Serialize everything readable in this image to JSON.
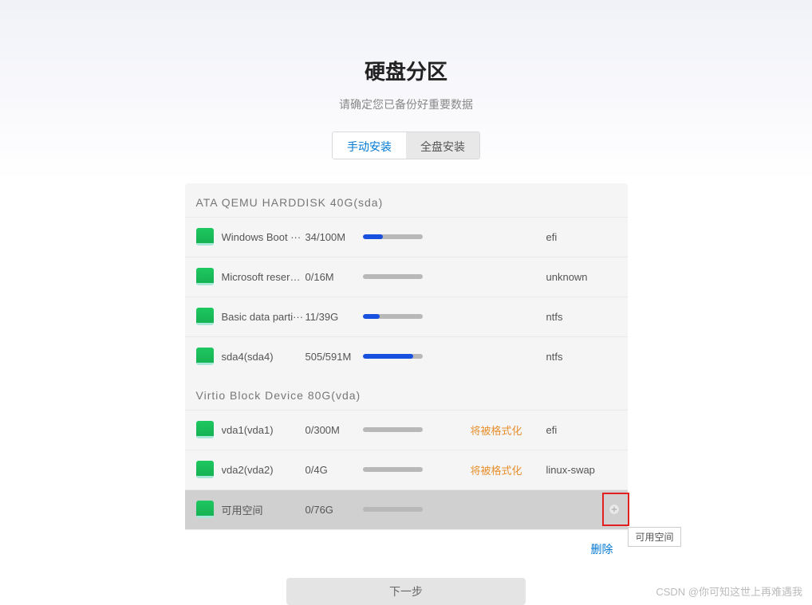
{
  "header": {
    "title": "硬盘分区",
    "subtitle": "请确定您已备份好重要数据"
  },
  "tabs": {
    "manual": "手动安装",
    "full": "全盘安装"
  },
  "disks": [
    {
      "label": "ATA  QEMU  HARDDISK  40G(sda)",
      "partitions": [
        {
          "name": "Windows Boot ···",
          "size": "34/100M",
          "progress": 34,
          "status": "",
          "fs": "efi"
        },
        {
          "name": "Microsoft reserv···",
          "size": "0/16M",
          "progress": 0,
          "status": "",
          "fs": "unknown"
        },
        {
          "name": "Basic  data  parti···",
          "size": "11/39G",
          "progress": 28,
          "status": "",
          "fs": "ntfs"
        },
        {
          "name": "sda4(sda4)",
          "size": "505/591M",
          "progress": 85,
          "status": "",
          "fs": "ntfs"
        }
      ]
    },
    {
      "label": "Virtio  Block  Device  80G(vda)",
      "partitions": [
        {
          "name": "vda1(vda1)",
          "size": "0/300M",
          "progress": 0,
          "status": "将被格式化",
          "fs": "efi"
        },
        {
          "name": "vda2(vda2)",
          "size": "0/4G",
          "progress": 0,
          "status": "将被格式化",
          "fs": "linux-swap"
        },
        {
          "name": "可用空间",
          "size": "0/76G",
          "progress": 0,
          "status": "",
          "fs": "",
          "selected": true,
          "add_icon": true
        }
      ]
    }
  ],
  "tooltip": "可用空间",
  "actions": {
    "delete": "删除",
    "next": "下一步"
  },
  "watermark": "CSDN @你可知这世上再难遇我"
}
